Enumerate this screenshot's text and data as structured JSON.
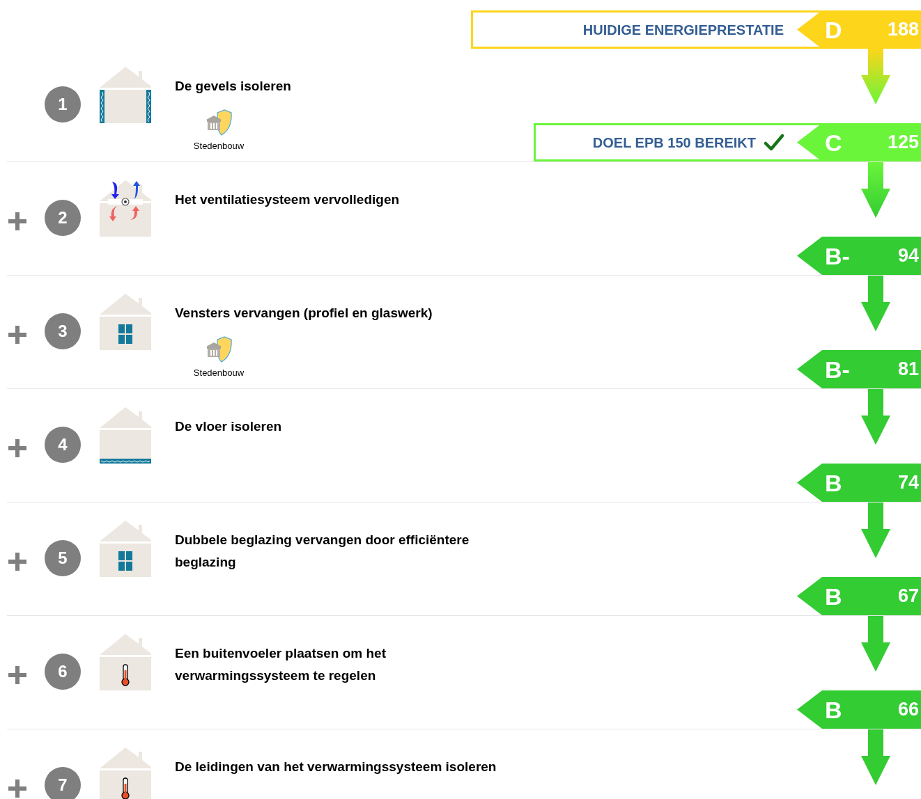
{
  "current": {
    "text": "HUIDIGE ENERGIEPRESTATIE",
    "achieved": false,
    "class": "D",
    "value": "188",
    "color": "#fdd51a"
  },
  "steps": [
    {
      "number": "1",
      "title": "De gevels isoleren",
      "kind": "facade",
      "expandable": false,
      "permit": "Stedenbouw",
      "result": {
        "text": "DOEL EPB 150 BEREIKT",
        "achieved": true,
        "class": "C",
        "value": "125",
        "color": "#6af53a"
      }
    },
    {
      "number": "2",
      "title": "Het ventilatiesysteem vervolledigen",
      "kind": "ventilation",
      "expandable": true,
      "result": {
        "class": "B-",
        "value": "94",
        "color": "#33cc33"
      }
    },
    {
      "number": "3",
      "title": "Vensters vervangen (profiel en glaswerk)",
      "kind": "window",
      "expandable": true,
      "permit": "Stedenbouw",
      "result": {
        "class": "B-",
        "value": "81",
        "color": "#33cc33"
      }
    },
    {
      "number": "4",
      "title": "De vloer isoleren",
      "kind": "floor",
      "expandable": true,
      "result": {
        "class": "B",
        "value": "74",
        "color": "#33cc33"
      }
    },
    {
      "number": "5",
      "title": "Dubbele beglazing vervangen door efficiëntere beglazing",
      "kind": "window",
      "expandable": true,
      "result": {
        "class": "B",
        "value": "67",
        "color": "#33cc33"
      }
    },
    {
      "number": "6",
      "title": "Een buitenvoeler plaatsen om het verwarmingssysteem te regelen",
      "kind": "thermometer",
      "expandable": true,
      "result": {
        "class": "B",
        "value": "66",
        "color": "#33cc33"
      }
    },
    {
      "number": "7",
      "title": "De leidingen van het verwarmingssysteem isoleren",
      "kind": "thermometer",
      "expandable": true
    }
  ]
}
